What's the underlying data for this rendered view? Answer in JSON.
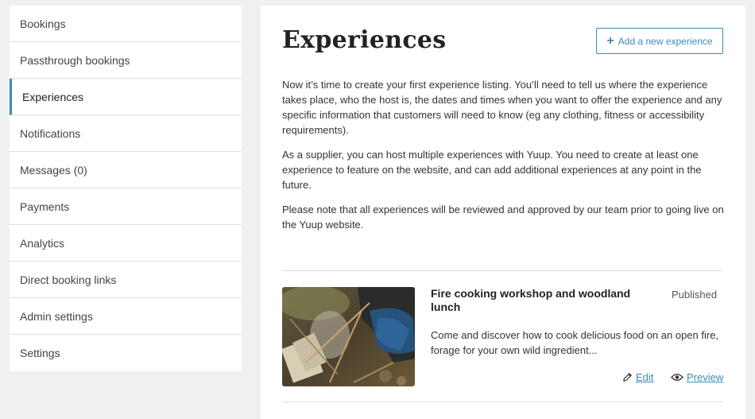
{
  "sidebar": {
    "items": [
      {
        "label": "Bookings"
      },
      {
        "label": "Passthrough bookings"
      },
      {
        "label": "Experiences"
      },
      {
        "label": "Notifications"
      },
      {
        "label": "Messages (0)"
      },
      {
        "label": "Payments"
      },
      {
        "label": "Analytics"
      },
      {
        "label": "Direct booking links"
      },
      {
        "label": "Admin settings"
      },
      {
        "label": "Settings"
      }
    ],
    "active_index": 2
  },
  "main": {
    "title": "Experiences",
    "add_button": {
      "label": "Add a new experience",
      "icon": "plus-icon"
    },
    "intro": [
      "Now it’s time to create your first experience listing. You’ll need to tell us where the experience takes place, who the host is, the dates and times when you want to offer the experience and any specific information that customers will need to know (eg any clothing, fitness or accessibility requirements).",
      "As a supplier, you can host multiple experiences with Yuup. You need to create at least one experience to feature on the website, and can add additional experiences at any point in the future.",
      "Please note that all experiences will be reviewed and approved by our team prior to going live on the Yuup website."
    ],
    "experience": {
      "title": "Fire cooking workshop and woodland lunch",
      "status": "Published",
      "description": "Come and discover how to cook delicious food on an open fire, forage for your own wild ingredient...",
      "edit_label": "Edit",
      "preview_label": "Preview"
    }
  },
  "colors": {
    "accent": "#3b8bb8",
    "background": "#f0f0f0",
    "panel": "#ffffff"
  }
}
